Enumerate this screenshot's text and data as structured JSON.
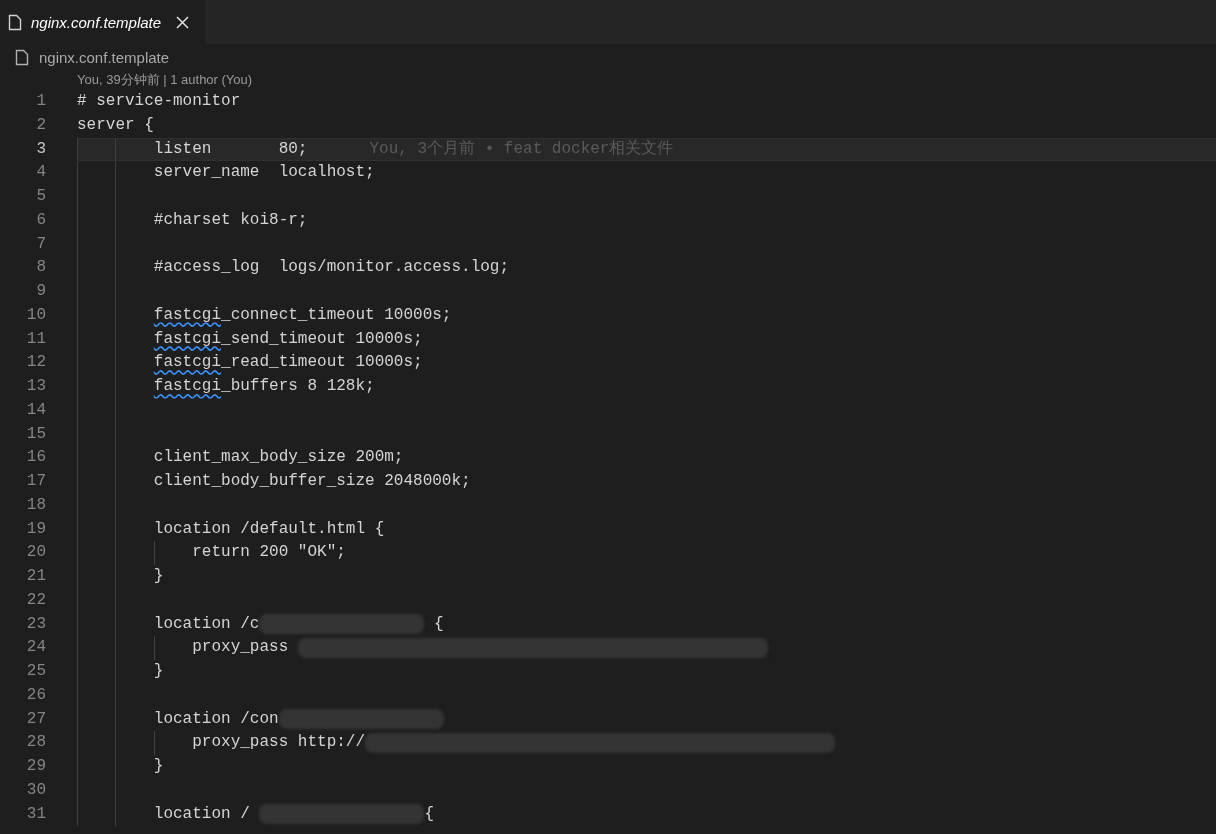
{
  "tabs": [
    {
      "label": "nginx.conf.template",
      "selected": true,
      "preview": true
    }
  ],
  "breadcrumb": {
    "file": "nginx.conf.template"
  },
  "codelens": "You, 39分钟前 | 1 author (You)",
  "lines": [
    {
      "number": "1",
      "current": false,
      "segments": [
        {
          "kind": "text",
          "text": "# service-monitor"
        }
      ]
    },
    {
      "number": "2",
      "current": false,
      "segments": [
        {
          "kind": "text",
          "text": "server {"
        }
      ]
    },
    {
      "number": "3",
      "current": true,
      "segments": [
        {
          "kind": "text",
          "text": "        listen       80;"
        }
      ],
      "blame": "You, 3个月前 • feat docker相关文件"
    },
    {
      "number": "4",
      "current": false,
      "segments": [
        {
          "kind": "text",
          "text": "        server_name  localhost;"
        }
      ]
    },
    {
      "number": "5",
      "current": false
    },
    {
      "number": "6",
      "current": false,
      "segments": [
        {
          "kind": "text",
          "text": "        #charset koi8-r;"
        }
      ]
    },
    {
      "number": "7",
      "current": false
    },
    {
      "number": "8",
      "current": false,
      "segments": [
        {
          "kind": "text",
          "text": "        #access_log  logs/monitor.access.log;"
        }
      ]
    },
    {
      "number": "9",
      "current": false
    },
    {
      "number": "10",
      "current": false,
      "segments": [
        {
          "kind": "text",
          "text": "        fastcgi",
          "squiggle": true
        },
        {
          "kind": "text",
          "text": "_connect_timeout 10000s;"
        }
      ]
    },
    {
      "number": "11",
      "current": false,
      "segments": [
        {
          "kind": "text",
          "text": "        fastcgi",
          "squiggle": true
        },
        {
          "kind": "text",
          "text": "_send_timeout 10000s;"
        }
      ]
    },
    {
      "number": "12",
      "current": false,
      "segments": [
        {
          "kind": "text",
          "text": "        fastcgi",
          "squiggle": true
        },
        {
          "kind": "text",
          "text": "_read_timeout 10000s;"
        }
      ]
    },
    {
      "number": "13",
      "current": false,
      "segments": [
        {
          "kind": "text",
          "text": "        fastcgi",
          "squiggle": true
        },
        {
          "kind": "text",
          "text": "_buffers 8 128k;"
        }
      ]
    },
    {
      "number": "14",
      "current": false
    },
    {
      "number": "15",
      "current": false
    },
    {
      "number": "16",
      "current": false,
      "segments": [
        {
          "kind": "text",
          "text": "        client_max_body_size 200m;"
        }
      ]
    },
    {
      "number": "17",
      "current": false,
      "segments": [
        {
          "kind": "text",
          "text": "        client_body_buffer_size 2048000k;"
        }
      ]
    },
    {
      "number": "18",
      "current": false
    },
    {
      "number": "19",
      "current": false,
      "segments": [
        {
          "kind": "text",
          "text": "        location /default.html {"
        }
      ]
    },
    {
      "number": "20",
      "current": false,
      "segments": [
        {
          "kind": "text",
          "text": "            return 200 \"OK\";"
        }
      ]
    },
    {
      "number": "21",
      "current": false,
      "segments": [
        {
          "kind": "text",
          "text": "        }"
        }
      ]
    },
    {
      "number": "22",
      "current": false
    },
    {
      "number": "23",
      "current": false,
      "segments": [
        {
          "kind": "text",
          "text": "        location /c"
        },
        {
          "kind": "redacted"
        },
        {
          "kind": "text",
          "text": " {"
        }
      ]
    },
    {
      "number": "24",
      "current": false,
      "segments": [
        {
          "kind": "text",
          "text": "            proxy_pass "
        },
        {
          "kind": "redacted"
        }
      ]
    },
    {
      "number": "25",
      "current": false,
      "segments": [
        {
          "kind": "text",
          "text": "        }"
        }
      ]
    },
    {
      "number": "26",
      "current": false
    },
    {
      "number": "27",
      "current": false,
      "segments": [
        {
          "kind": "text",
          "text": "        location /con"
        },
        {
          "kind": "redacted"
        }
      ]
    },
    {
      "number": "28",
      "current": false,
      "segments": [
        {
          "kind": "text",
          "text": "            proxy_pass http://"
        },
        {
          "kind": "redacted"
        }
      ]
    },
    {
      "number": "29",
      "current": false,
      "segments": [
        {
          "kind": "text",
          "text": "        }"
        }
      ]
    },
    {
      "number": "30",
      "current": false
    },
    {
      "number": "31",
      "current": false,
      "segments": [
        {
          "kind": "text",
          "text": "        location / "
        },
        {
          "kind": "redacted"
        },
        {
          "kind": "text",
          "text": "{"
        }
      ]
    }
  ]
}
